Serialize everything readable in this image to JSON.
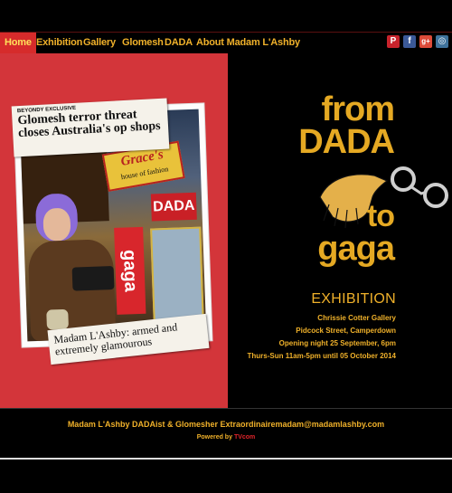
{
  "nav": {
    "items": [
      {
        "label": "Home",
        "active": true
      },
      {
        "label": "Exhibition"
      },
      {
        "label": "Gallery"
      },
      {
        "label": "Glomesh"
      },
      {
        "label": "DADA"
      },
      {
        "label": "About Madam L'Ashby"
      }
    ]
  },
  "social": {
    "icons": [
      {
        "name": "pinterest-icon",
        "glyph": "P",
        "color": "#c8232c"
      },
      {
        "name": "facebook-icon",
        "glyph": "f",
        "color": "#3b5998"
      },
      {
        "name": "google-plus-icon",
        "glyph": "g+",
        "color": "#dd4b39"
      },
      {
        "name": "instagram-icon",
        "glyph": "◎",
        "color": "#3f729b"
      }
    ]
  },
  "clipping_top": {
    "kicker": "BEYONDY EXCLUSIVE",
    "headline": "Glomesh terror threat closes Australia's op shops"
  },
  "photo": {
    "sign_script": "Grace's",
    "sign_sub": "house of fashion",
    "shop_sign_left": "gaga",
    "shop_sign_right": "DADA"
  },
  "clipping_bottom": {
    "headline": "Madam L'Ashby: armed and extremely glamourous"
  },
  "hero": {
    "line1": "from",
    "line2": "DADA",
    "line3": "to",
    "line4": "gaga"
  },
  "exhibition": {
    "heading": "EXHIBITION",
    "venue": "Chrissie Cotter Gallery",
    "address": "Pidcock Street, Camperdown",
    "opening": "Opening night 25 September, 6pm",
    "hours": "Thurs-Sun 11am-5pm until 05 October 2014"
  },
  "footer": {
    "contact": "Madam L'Ashby DADAist & Glomesher Extraordinairemadam@madamlashby.com",
    "powered_prefix": "Powered by",
    "powered_brand_tv": "TV",
    "powered_brand_com": "com"
  },
  "colors": {
    "accent": "#f0b12a",
    "panel_red": "#d3353a",
    "nav_active": "#d62b2b"
  }
}
